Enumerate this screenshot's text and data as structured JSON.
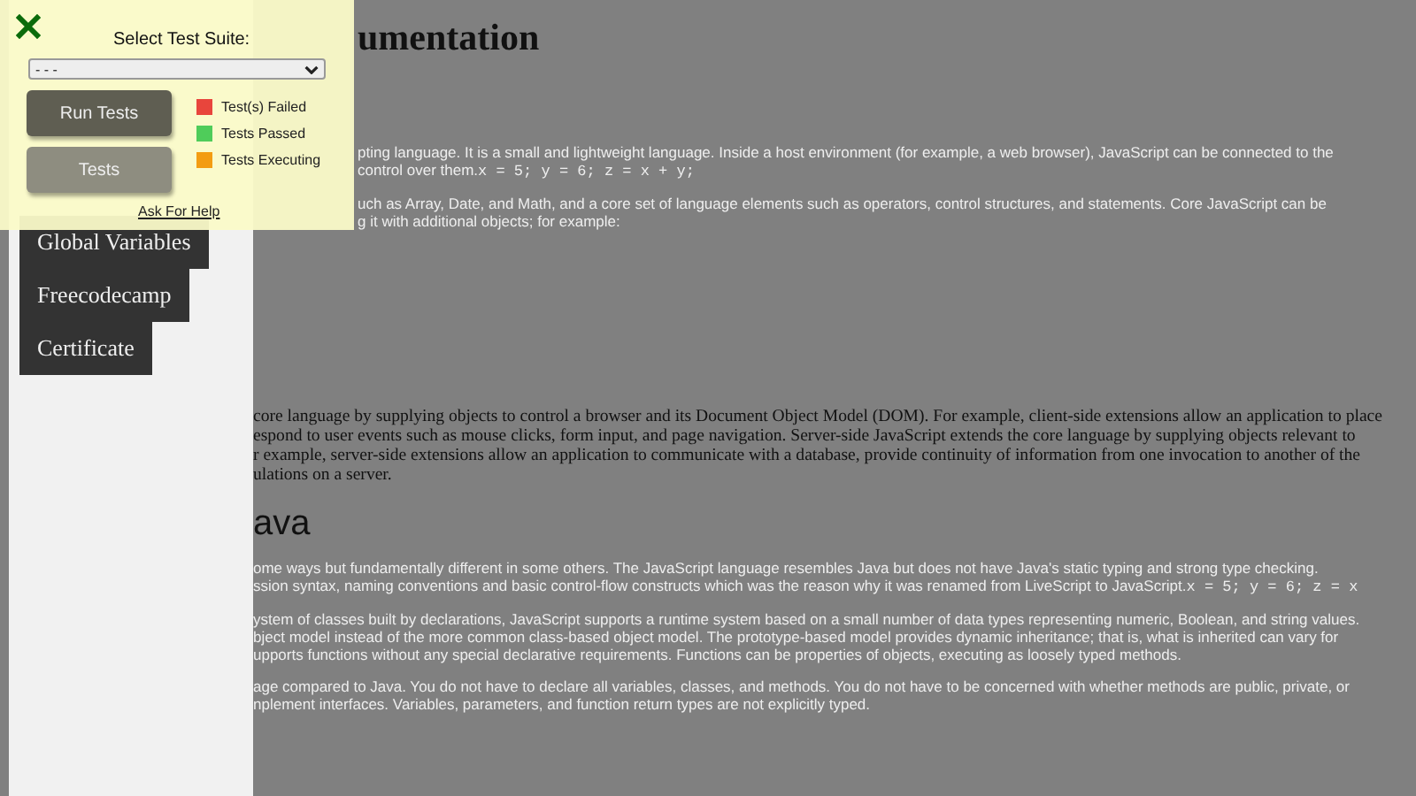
{
  "test_panel": {
    "label": "Select Test Suite:",
    "select_value": "- - -",
    "buttons": [
      "Run Tests",
      "Tests"
    ],
    "legend": [
      {
        "label": "Test(s) Failed",
        "color": "#e8453c"
      },
      {
        "label": "Tests Passed",
        "color": "#4fcc5a"
      },
      {
        "label": "Tests Executing",
        "color": "#f39c12"
      }
    ],
    "help_link": "Ask For Help"
  },
  "sidebar": {
    "items": [
      "Global Variables",
      "Freecodecamp",
      "Certificate"
    ]
  },
  "main": {
    "heading": "umentation",
    "top_blocks": [
      {
        "kind": "sans",
        "lines": [
          {
            "text": "pting language. It is a small and lightweight language. Inside a host environment (for example, a web browser), JavaScript can be connected to the"
          },
          {
            "text": "control over them.",
            "code": "x = 5; y = 6; z = x + y;"
          }
        ]
      },
      {
        "kind": "sans",
        "lines": [
          {
            "text": "uch as Array, Date, and Math, and a core set of language elements such as operators, control structures, and statements. Core JavaScript can be"
          },
          {
            "text": "g it with additional objects; for example:"
          }
        ]
      }
    ],
    "blocks": [
      {
        "kind": "serif",
        "lines": [
          {
            "text": "core language by supplying objects to control a browser and its Document Object Model (DOM). For example, client-side extensions allow an application to place"
          },
          {
            "text": "espond to user events such as mouse clicks, form input, and page navigation. Server-side JavaScript extends the core language by supplying objects relevant to"
          },
          {
            "text": "r example, server-side extensions allow an application to communicate with a database, provide continuity of information from one invocation to another of the"
          },
          {
            "text": "ulations on a server."
          }
        ]
      },
      {
        "kind": "heading",
        "lines": [
          {
            "text": "ava"
          }
        ]
      },
      {
        "kind": "sans",
        "lines": [
          {
            "text": "ome ways but fundamentally different in some others. The JavaScript language resembles Java but does not have Java's static typing and strong type checking."
          },
          {
            "text": "ssion syntax, naming conventions and basic control-flow constructs which was the reason why it was renamed from LiveScript to JavaScript.",
            "code": "x = 5; y = 6; z = x"
          }
        ]
      },
      {
        "kind": "sans",
        "lines": [
          {
            "text": "ystem of classes built by declarations, JavaScript supports a runtime system based on a small number of data types representing numeric, Boolean, and string values."
          },
          {
            "text": "bject model instead of the more common class-based object model. The prototype-based model provides dynamic inheritance; that is, what is inherited can vary for"
          },
          {
            "text": "upports functions without any special declarative requirements. Functions can be properties of objects, executing as loosely typed methods."
          }
        ]
      },
      {
        "kind": "sans",
        "lines": [
          {
            "text": "age compared to Java. You do not have to declare all variables, classes, and methods. You do not have to be concerned with whether methods are public, private, or"
          },
          {
            "text": "nplement interfaces. Variables, parameters, and function return types are not explicitly typed."
          }
        ]
      }
    ]
  }
}
